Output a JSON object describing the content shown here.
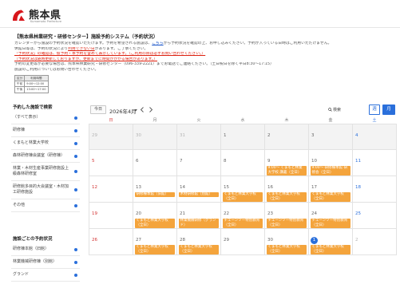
{
  "header": {
    "title": "熊本県",
    "subtitle": "Kumamoto Prefecture"
  },
  "intro": {
    "heading": "【熊本県林業研究・研修センター】施設予約システム（予約状況）",
    "lines": [
      {
        "segments": [
          {
            "text": "カレンダーから施設の予約状況を確認いただけます。予約を希望される施設は、",
            "style": "normal"
          },
          {
            "text": "こちら",
            "style": "link"
          },
          {
            "text": "から予約状況を確認の上、お申し込みください。予約が入っている日時はご利用いただけません。",
            "style": "normal"
          }
        ]
      },
      {
        "segments": [
          {
            "text": "休館日等は、予約の状況により",
            "style": "normal"
          },
          {
            "text": "利用できない日",
            "style": "red-underline"
          },
          {
            "text": "があります。ご了承ください。",
            "style": "normal"
          }
        ]
      },
      {
        "segments": [
          {
            "text": "「予約状況」の確認は、仮予約・本予約を含めて表示しています。（ご利用の際は必ずお問い合わせください。）",
            "style": "red-underline"
          }
        ]
      },
      {
        "segments": [
          {
            "text": "（予約状況は随時更新しておりますが、更新までに時間がかかる場合があります。）",
            "style": "red-underline"
          }
        ]
      },
      {
        "segments": [
          {
            "text": "予約の変更等が必要な場合は、熊本県林業研究・研修センター（096-339-2221）までお電話でご連絡ください。（土日祝日を除く平日8:30～17:15）",
            "style": "normal"
          }
        ]
      },
      {
        "segments": [
          {
            "text": "施設のご利用についてはお問い合わせください。",
            "style": "normal"
          }
        ]
      }
    ],
    "table": {
      "headers": [
        "区分",
        "利用時間"
      ],
      "rows": [
        [
          "午前",
          "9:00～12:00"
        ],
        [
          "午後",
          "13:00～17:00"
        ]
      ]
    }
  },
  "sidebar": {
    "search_heading": "予約した施設で検索",
    "facilities": [
      "（すべて表示）",
      "研修棟",
      "くまもと林業大学校",
      "森林研修棟会議室（研修棟）",
      "林業・木材生産事業研修施設上級森林研修室",
      "研修館多目的大会議室・木材加工研修施設",
      "その他"
    ],
    "status_heading": "施設ごとの予約状況",
    "status_items": [
      "研修棟本館（旧館）",
      "林業機械研修棟（別館）",
      "グランド"
    ]
  },
  "calendar": {
    "today_label": "今日",
    "month_label": "2026年4月",
    "search_label": "検索",
    "view_week": "週",
    "view_month": "月",
    "weekdays": [
      "日",
      "月",
      "火",
      "水",
      "木",
      "金",
      "土"
    ],
    "weeks": [
      {
        "shaded": true,
        "days": [
          {
            "date": "29",
            "other_month": true,
            "events": []
          },
          {
            "date": "30",
            "other_month": true,
            "events": []
          },
          {
            "date": "31",
            "other_month": true,
            "events": []
          },
          {
            "date": "1",
            "events": []
          },
          {
            "date": "2",
            "events": []
          },
          {
            "date": "3",
            "events": []
          },
          {
            "date": "4",
            "events": []
          }
        ]
      },
      {
        "days": [
          {
            "date": "5",
            "events": []
          },
          {
            "date": "6",
            "events": []
          },
          {
            "date": "7",
            "events": []
          },
          {
            "date": "8",
            "events": []
          },
          {
            "date": "9",
            "events": [
              "9:00～ くまもと林業大学校 講義（全日）"
            ]
          },
          {
            "date": "10",
            "events": [
              "9:00～ 研修棟本館 研修会（全日）"
            ]
          },
          {
            "date": "11",
            "events": []
          }
        ]
      },
      {
        "days": [
          {
            "date": "12",
            "events": []
          },
          {
            "date": "13",
            "events": [
              "研修棟本館（旧館）"
            ]
          },
          {
            "date": "14",
            "events": [
              "木材研修館（別館）"
            ]
          },
          {
            "date": "15",
            "events": [
              "くまもと林業大学校（全日）"
            ]
          },
          {
            "date": "16",
            "events": [
              "くまもと林業大学校（全日）"
            ]
          },
          {
            "date": "17",
            "events": [
              "くまもと林業大学校（全日）"
            ]
          },
          {
            "date": "18",
            "events": []
          }
        ]
      },
      {
        "days": [
          {
            "date": "19",
            "events": []
          },
          {
            "date": "20",
            "events": [
              "くまもと林業大学校（全日）"
            ]
          },
          {
            "date": "21",
            "events": [
              "林業機械研修（グランド）"
            ]
          },
          {
            "date": "22",
            "events": [
              "チェーンソー特別教育（全日）"
            ]
          },
          {
            "date": "23",
            "events": [
              "チェーンソー特別教育（全日）"
            ]
          },
          {
            "date": "24",
            "events": [
              "チェーンソー特別教育（全日）"
            ]
          },
          {
            "date": "25",
            "events": []
          }
        ]
      },
      {
        "days": [
          {
            "date": "26",
            "events": []
          },
          {
            "date": "27",
            "events": [
              "くまもと林業大学校（全日）"
            ]
          },
          {
            "date": "28",
            "events": [
              "くまもと林業大学校（全日）"
            ]
          },
          {
            "date": "29",
            "events": []
          },
          {
            "date": "30",
            "events": [
              "くまもと林業大学校（全日）"
            ]
          },
          {
            "date": "1",
            "other_month": true,
            "today": true,
            "events": [
              "くまもと林業大学校（全日）"
            ]
          },
          {
            "date": "2",
            "other_month": true,
            "events": []
          }
        ]
      }
    ]
  },
  "colors": {
    "brand_red": "#d7161b",
    "accent_blue": "#2a6fdb",
    "event_orange": "#f4a43c",
    "sunday": "#d33333",
    "saturday": "#2a6fdb"
  }
}
